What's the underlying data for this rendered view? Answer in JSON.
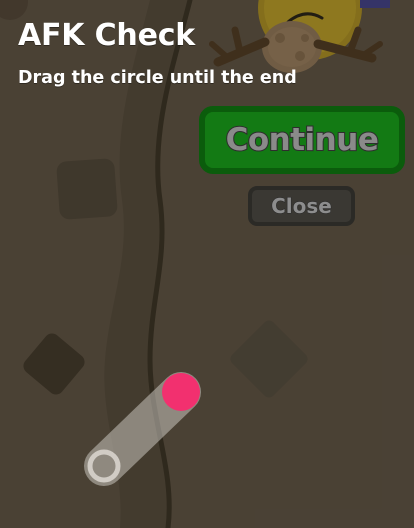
{
  "dialog": {
    "title": "AFK Check",
    "instruction": "Drag the circle until the end",
    "continue_label": "Continue",
    "close_label": "Close"
  },
  "drag_slider": {
    "progress": 1.0,
    "handle_color": "#f2306f",
    "track_color": "#c8c4bd"
  },
  "colors": {
    "ground": "#6b5e4d",
    "road": "#5e5343",
    "continue_fill": "#137a14",
    "continue_border": "#0b5c0c",
    "close_fill": "#3a3833"
  },
  "icons": {
    "background_character": "sun-character-icon",
    "branch": "branch-icon"
  }
}
